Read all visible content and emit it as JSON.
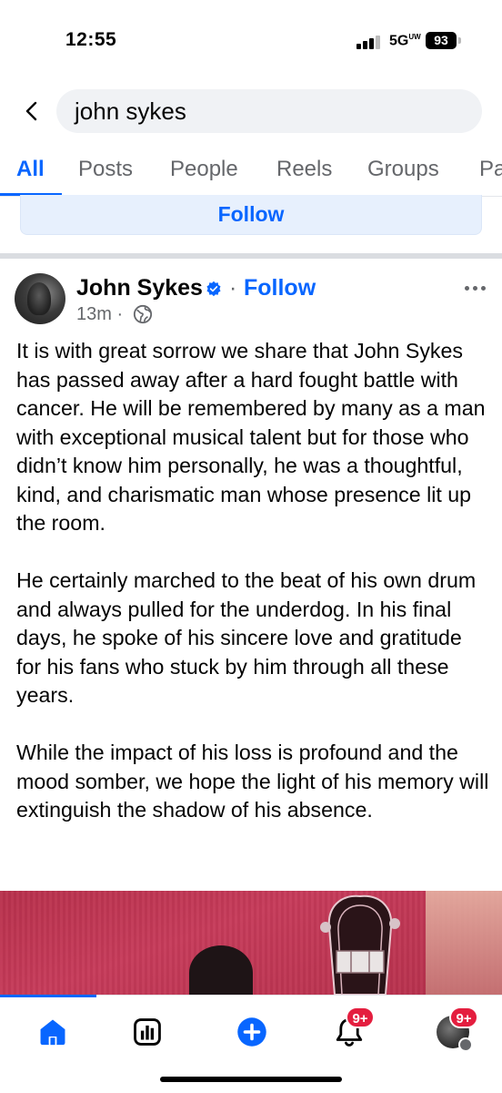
{
  "status_bar": {
    "time": "12:55",
    "network": "5G",
    "network_suffix": "UW",
    "battery": "93"
  },
  "search": {
    "query": "john sykes"
  },
  "tabs": [
    {
      "label": "All",
      "active": true
    },
    {
      "label": "Posts"
    },
    {
      "label": "People"
    },
    {
      "label": "Reels"
    },
    {
      "label": "Groups"
    },
    {
      "label": "Pa"
    }
  ],
  "follow_bar": {
    "label": "Follow"
  },
  "post": {
    "author": "John Sykes",
    "separator": "·",
    "follow_label": "Follow",
    "time": "13m ·",
    "paragraphs": [
      "It is with great sorrow we share that John Sykes has passed away after a hard fought battle with cancer. He will be remembered by many as a man with exceptional musical talent but for those who didn’t know him personally, he was a thoughtful, kind, and charismatic man whose presence lit up the room.",
      "He certainly marched to the beat of his own drum and always pulled for the underdog. In his final days, he spoke of his sincere love and gratitude for his fans who stuck by him through all these years.",
      "While the impact of his loss is profound and the mood somber, we hope the light of his memory will extinguish the shadow of his absence."
    ]
  },
  "bottom_nav": {
    "items": [
      {
        "icon": "home-icon",
        "active": true
      },
      {
        "icon": "feeds-icon"
      },
      {
        "icon": "create-icon"
      },
      {
        "icon": "notifications-icon",
        "badge": "9+"
      },
      {
        "icon": "profile-icon",
        "badge": "9+"
      }
    ]
  },
  "colors": {
    "accent": "#0866ff",
    "badge": "#e41e3f",
    "secondary_text": "#65676b"
  }
}
